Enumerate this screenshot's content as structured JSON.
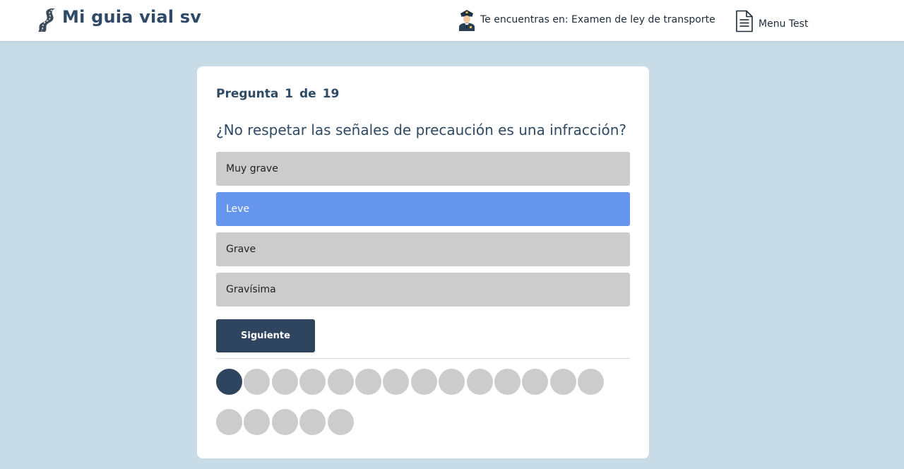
{
  "header": {
    "brand": "Mi guia vial sv",
    "location": "Te encuentras en: Examen de ley de transporte",
    "menu_label": "Menu Test"
  },
  "quiz": {
    "counter": "Pregunta 1 de 19",
    "current": 1,
    "total": 19,
    "question": "¿No respetar las señales de precaución es una infracción?",
    "options": [
      {
        "label": "Muy grave",
        "selected": false
      },
      {
        "label": "Leve",
        "selected": true
      },
      {
        "label": "Grave",
        "selected": false
      },
      {
        "label": "Gravísima",
        "selected": false
      }
    ],
    "next_label": "Siguiente"
  },
  "colors": {
    "background": "#c8dce8",
    "primary": "#2f445e",
    "selected": "#6595ec",
    "option": "#cccccc"
  },
  "icons": {
    "brand": "road-icon",
    "location": "police-officer-icon",
    "menu": "document-icon"
  }
}
